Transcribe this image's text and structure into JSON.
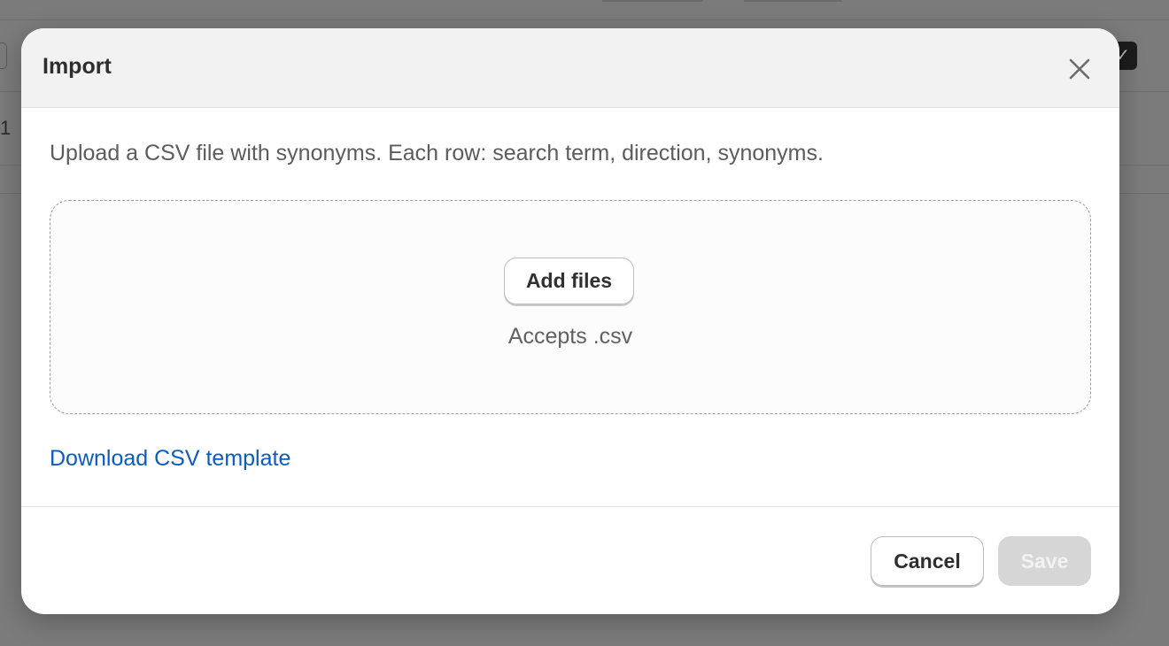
{
  "modal": {
    "title": "Import",
    "close_icon": "close-icon",
    "description": "Upload a CSV file with synonyms. Each row: search term, direction, synonyms.",
    "dropzone": {
      "add_files_label": "Add files",
      "accepts_text": "Accepts .csv"
    },
    "download_link_label": "Download CSV template",
    "cancel_label": "Cancel",
    "save_label": "Save",
    "save_disabled": true
  },
  "background": {
    "row_number": "1",
    "checkmark_icon": "checkmark-icon"
  },
  "colors": {
    "overlay": "#7b7b7b",
    "link": "#0b5cbf",
    "save_disabled_bg": "#d6d6d6"
  }
}
